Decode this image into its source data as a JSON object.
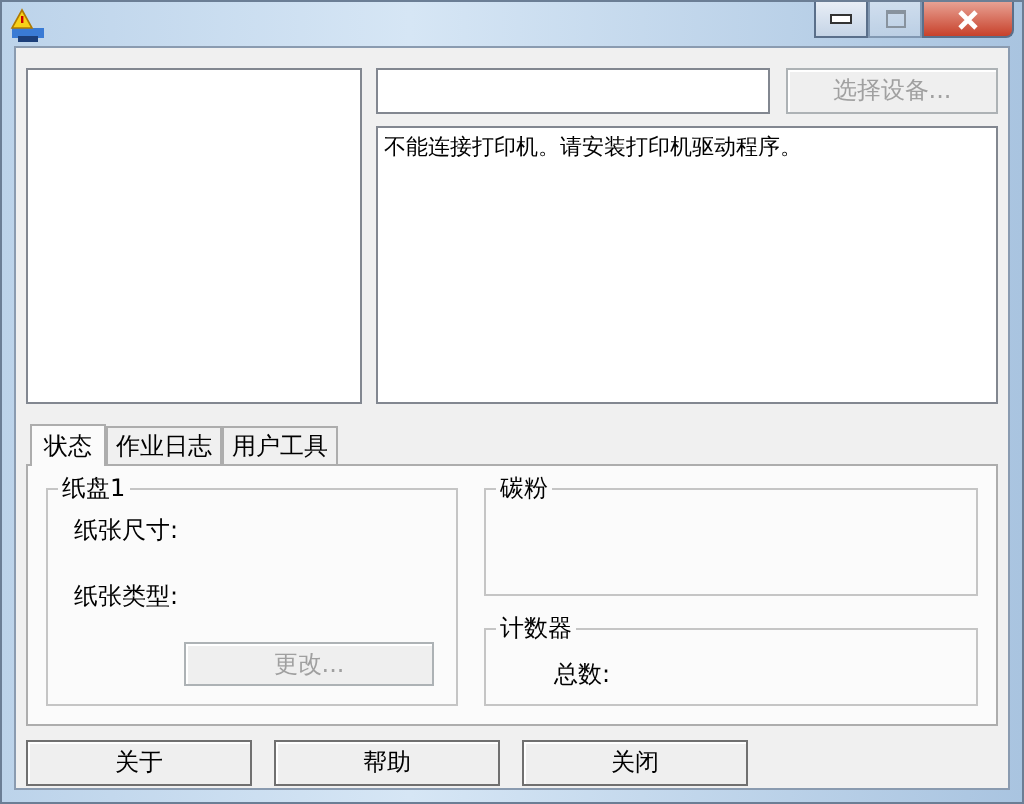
{
  "window": {
    "controls": [
      {
        "kind": "minimize"
      },
      {
        "kind": "maximize",
        "disabled": true
      },
      {
        "kind": "close"
      }
    ]
  },
  "select_device_button": {
    "label": "选择设备...",
    "disabled": true
  },
  "message": "不能连接打印机。请安装打印机驱动程序。",
  "tabs": [
    {
      "label": "状态",
      "selected": true
    },
    {
      "label": "作业日志",
      "selected": false
    },
    {
      "label": "用户工具",
      "selected": false
    }
  ],
  "tray": {
    "title": "纸盘1",
    "paper_size": "纸张尺寸:",
    "paper_type": "纸张类型:",
    "change_button": {
      "label": "更改...",
      "disabled": true
    }
  },
  "toner": {
    "title": "碳粉"
  },
  "counter": {
    "title": "计数器",
    "total": "总数:"
  },
  "buttons": [
    "关于",
    "帮助",
    "关闭"
  ]
}
